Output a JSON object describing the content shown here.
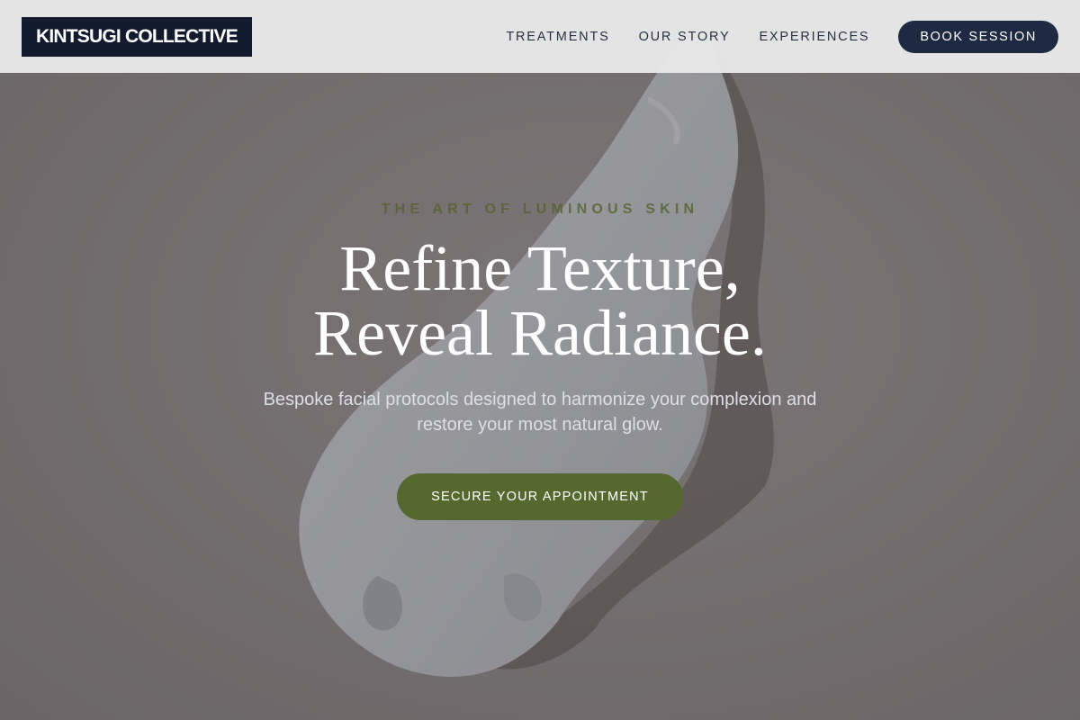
{
  "header": {
    "logo": "KINTSUGI COLLECTIVE",
    "nav": [
      {
        "label": "TREATMENTS"
      },
      {
        "label": "OUR STORY"
      },
      {
        "label": "EXPERIENCES"
      }
    ],
    "book_button": "BOOK SESSION"
  },
  "hero": {
    "eyebrow": "THE ART OF LUMINOUS SKIN",
    "headline_line1": "Refine Texture,",
    "headline_line2": "Reveal Radiance.",
    "subtext": "Bespoke facial protocols designed to harmonize your complexion and restore your most natural glow.",
    "cta": "SECURE YOUR APPOINTMENT"
  },
  "colors": {
    "logo_bg": "#121b2e",
    "book_button_bg": "#1e2a42",
    "accent_green": "#55692f",
    "background_beige": "#8b8586",
    "cream_swatch": "#c9ccd2"
  }
}
